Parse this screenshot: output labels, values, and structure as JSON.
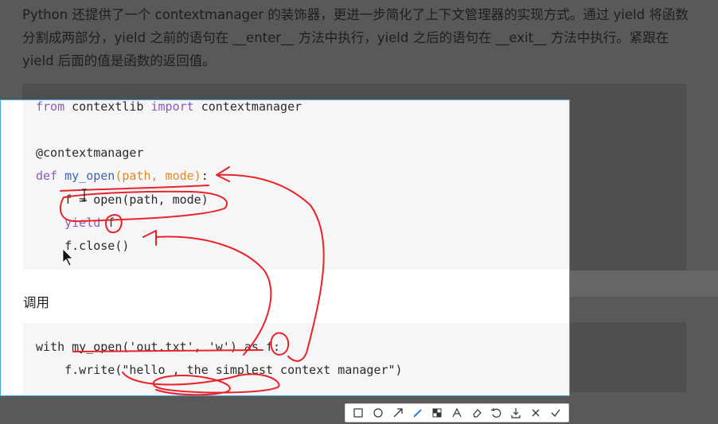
{
  "intro_text": "Python 还提供了一个 contextmanager 的装饰器，更进一步简化了上下文管理器的实现方式。通过 yield 将函数分割成两部分，yield 之前的语句在 __enter__ 方法中执行，yield 之后的语句在 __exit__ 方法中执行。紧跟在 yield 后面的值是函数的返回值。",
  "code_block_1": {
    "line1": {
      "kw1": "from",
      "mod": " contextlib ",
      "kw2": "import",
      "name": " contextmanager"
    },
    "line2": "@contextmanager",
    "line3": {
      "kw": "def",
      "fn": " my_open",
      "params": "(path, mode)",
      "colon": ":"
    },
    "line4": "    f = open(path, mode)",
    "line5": {
      "indent": "    ",
      "kw": "yield",
      "rest": " f"
    },
    "line6": "    f.close()"
  },
  "section_label": "调用",
  "code_block_2": {
    "line1": "with my_open('out.txt', 'w') as f:",
    "line2": "    f.write(\"hello , the simplest context manager\")"
  },
  "toolbar": {
    "tools": [
      "rectangle",
      "ellipse",
      "arrow",
      "pen",
      "mosaic",
      "text",
      "eraser",
      "undo",
      "save",
      "cancel",
      "confirm"
    ],
    "active_tool": "pen",
    "accent_color": "#2a7ff0"
  },
  "colors": {
    "annotation_ink": "#e8232a",
    "selection_border": "#3aa6e0",
    "keyword": "#8a5cb8",
    "param": "#e08a24"
  }
}
